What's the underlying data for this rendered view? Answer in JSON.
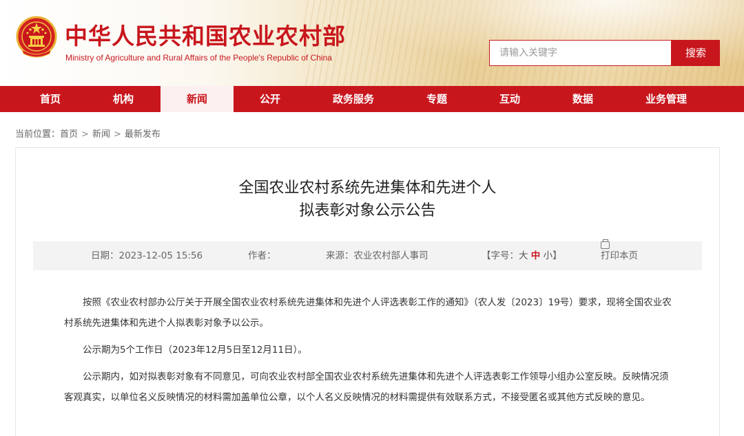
{
  "header": {
    "title": "中华人民共和国农业农村部",
    "subtitle": "Ministry of Agriculture and Rural Affairs of the People's Republic of China",
    "search_placeholder": "请输入关键字",
    "search_button": "搜索"
  },
  "nav": {
    "items": [
      {
        "label": "首页"
      },
      {
        "label": "机构"
      },
      {
        "label": "新闻"
      },
      {
        "label": "公开"
      },
      {
        "label": "政务服务"
      },
      {
        "label": "专题"
      },
      {
        "label": "互动"
      },
      {
        "label": "数据"
      },
      {
        "label": "业务管理"
      }
    ],
    "active": "新闻"
  },
  "breadcrumb": {
    "prefix": "当前位置：",
    "items": [
      "首页",
      "新闻",
      "最新发布"
    ],
    "separator": ">"
  },
  "article": {
    "title_line1": "全国农业农村系统先进集体和先进个人",
    "title_line2": "拟表彰对象公示公告",
    "date": "日期：2023-12-05 15:56",
    "author": "作者：",
    "source": "来源：农业农村部人事司",
    "font_size_label": "【字号：",
    "font_big": "大",
    "font_mid": "中",
    "font_small": "小",
    "font_close": "】",
    "print": "打印本页",
    "paragraphs": [
      "按照《农业农村部办公厅关于开展全国农业农村系统先进集体和先进个人评选表彰工作的通知》（农人发〔2023〕19号）要求，现将全国农业农村系统先进集体和先进个人拟表彰对象予以公示。",
      "公示期为5个工作日（2023年12月5日至12月11日）。",
      "公示期内，如对拟表彰对象有不同意见，可向农业农村部全国农业农村系统先进集体和先进个人评选表彰工作领导小组办公室反映。反映情况须客观真实，以单位名义反映情况的材料需加盖单位公章，以个人名义反映情况的材料需提供有效联系方式，不接受匿名或其他方式反映的意见。"
    ]
  },
  "colors": {
    "brand_red": "#c8161d",
    "nav_active_bg": "#fdf0f0",
    "info_bar_bg": "#f3f3f3"
  },
  "icons": [
    "national-emblem-icon",
    "print-icon"
  ]
}
